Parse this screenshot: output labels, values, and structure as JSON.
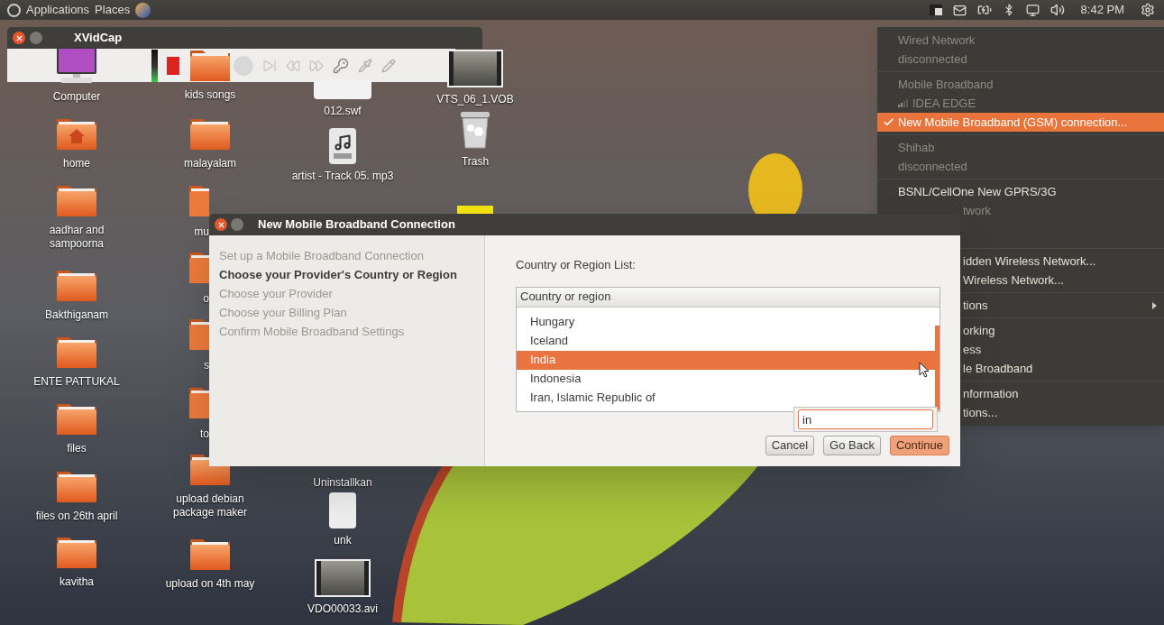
{
  "top_panel": {
    "menus": [
      {
        "label": "Applications"
      },
      {
        "label": "Places"
      }
    ],
    "clock": "8:42 PM"
  },
  "xvidcap": {
    "title": "XVidCap"
  },
  "desktop": {
    "columns": [
      [
        {
          "label": "Computer",
          "kind": "computer"
        },
        {
          "label": "home",
          "kind": "home"
        },
        {
          "label": "aadhar and sampoorna",
          "kind": "folder"
        },
        {
          "label": "Bakthiganam",
          "kind": "folder"
        },
        {
          "label": "ENTE  PATTUKAL",
          "kind": "folder"
        },
        {
          "label": "files",
          "kind": "folder"
        },
        {
          "label": "files on 26th april",
          "kind": "folder"
        },
        {
          "label": "kavitha",
          "kind": "folder"
        }
      ],
      [
        {
          "label": "kids songs",
          "kind": "folder"
        },
        {
          "label": "malayalam",
          "kind": "folder"
        },
        {
          "label": "mu",
          "kind": "folder",
          "partly_hidden": true
        },
        {
          "label": "o",
          "kind": "folder",
          "partly_hidden": true
        },
        {
          "label": "s",
          "kind": "folder",
          "partly_hidden": true
        },
        {
          "label": "to",
          "kind": "folder",
          "partly_hidden": true
        },
        {
          "label": "upload debian package maker",
          "kind": "folder"
        },
        {
          "label": "upload on 4th may",
          "kind": "folder"
        }
      ],
      [
        {
          "label": "012.swf",
          "kind": "swf"
        },
        {
          "label": "artist - Track 05. mp3",
          "kind": "audio"
        },
        {
          "label": "Uninstallkan",
          "kind": "hidden"
        },
        {
          "label": "unk",
          "kind": "unknown"
        },
        {
          "label": "VDO00033.avi",
          "kind": "video"
        }
      ],
      [
        {
          "label": "VTS_06_1.VOB",
          "kind": "video"
        },
        {
          "label": "Trash",
          "kind": "trash"
        },
        {
          "kind": "yellow"
        }
      ]
    ]
  },
  "network_menu": {
    "items": [
      {
        "kind": "item",
        "label": "Wired Network",
        "disabled": true,
        "selected": false,
        "checked": false,
        "partly_hidden": false
      },
      {
        "kind": "item",
        "label": "disconnected",
        "disabled": true,
        "selected": false,
        "checked": false,
        "partly_hidden": false
      },
      {
        "kind": "separator"
      },
      {
        "kind": "item",
        "label": "Mobile Broadband",
        "disabled": true,
        "selected": false,
        "checked": false,
        "partly_hidden": false
      },
      {
        "kind": "signal",
        "label": "IDEA EDGE",
        "disabled": true,
        "selected": false,
        "checked": false,
        "partly_hidden": false
      },
      {
        "kind": "item",
        "label": "New Mobile Broadband (GSM) connection...",
        "disabled": false,
        "selected": true,
        "checked": true,
        "partly_hidden": false
      },
      {
        "kind": "separator"
      },
      {
        "kind": "item",
        "label": "Shihab",
        "disabled": true,
        "selected": false,
        "checked": false,
        "partly_hidden": false
      },
      {
        "kind": "item",
        "label": "disconnected",
        "disabled": true,
        "selected": false,
        "checked": false,
        "partly_hidden": false
      },
      {
        "kind": "separator"
      },
      {
        "kind": "item",
        "label": "BSNL/CellOne New GPRS/3G",
        "disabled": false,
        "selected": false,
        "checked": false,
        "partly_hidden": false
      },
      {
        "kind": "item",
        "label": "twork",
        "disabled": true,
        "selected": false,
        "partly_hidden": true
      },
      {
        "kind": "gap"
      },
      {
        "kind": "separator"
      },
      {
        "kind": "item",
        "label": "idden Wireless Network...",
        "disabled": false,
        "selected": false,
        "partly_hidden": true
      },
      {
        "kind": "item",
        "label": "Wireless Network...",
        "disabled": false,
        "selected": false,
        "partly_hidden": true
      },
      {
        "kind": "separator"
      },
      {
        "kind": "submenu",
        "label": "tions",
        "disabled": false,
        "selected": false,
        "partly_hidden": true
      },
      {
        "kind": "separator"
      },
      {
        "kind": "item",
        "label": "orking",
        "disabled": false,
        "selected": false,
        "partly_hidden": true
      },
      {
        "kind": "item",
        "label": "ess",
        "disabled": false,
        "selected": false,
        "partly_hidden": true
      },
      {
        "kind": "item",
        "label": "le Broadband",
        "disabled": false,
        "selected": false,
        "partly_hidden": true
      },
      {
        "kind": "separator"
      },
      {
        "kind": "item",
        "label": "nformation",
        "disabled": false,
        "selected": false,
        "partly_hidden": true
      },
      {
        "kind": "item",
        "label": "tions...",
        "disabled": false,
        "selected": false,
        "partly_hidden": true
      }
    ]
  },
  "dialog": {
    "title": "New Mobile Broadband Connection",
    "steps": [
      {
        "label": "Set up a Mobile Broadband Connection",
        "selected": false
      },
      {
        "label": "Choose your Provider's Country or Region",
        "selected": true
      },
      {
        "label": "Choose your Provider",
        "selected": false
      },
      {
        "label": "Choose your Billing Plan",
        "selected": false
      },
      {
        "label": "Confirm Mobile Broadband Settings",
        "selected": false
      }
    ],
    "list_label": "Country or Region List:",
    "list": {
      "column": "Country or region",
      "rows": [
        {
          "label": "Hungary",
          "selected": false
        },
        {
          "label": "Iceland",
          "selected": false
        },
        {
          "label": "India",
          "selected": true
        },
        {
          "label": "Indonesia",
          "selected": false
        },
        {
          "label": "Iran, Islamic Republic of",
          "selected": false
        }
      ]
    },
    "search": {
      "value": "in"
    },
    "buttons": [
      {
        "label": "Cancel",
        "kind": "default"
      },
      {
        "label": "Go Back",
        "kind": "default"
      },
      {
        "label": "Continue",
        "kind": "primary"
      }
    ]
  }
}
